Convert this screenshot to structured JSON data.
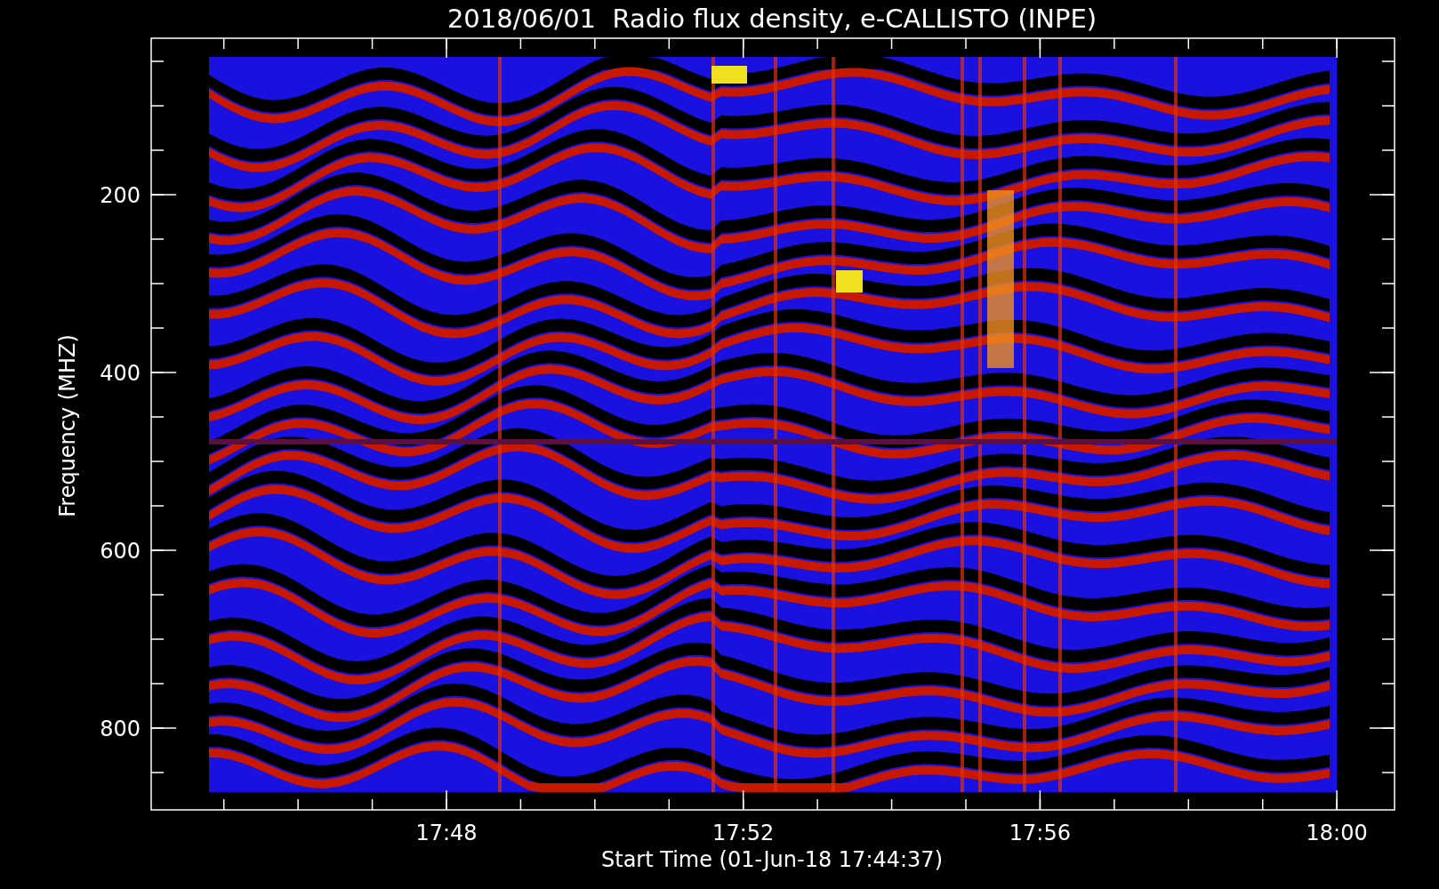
{
  "title": "2018/06/01  Radio flux density, e-CALLISTO (INPE)",
  "x_axis": {
    "label": "Start Time (01-Jun-18 17:44:37)",
    "ticks": [
      "17:48",
      "17:52",
      "17:56",
      "18:00"
    ]
  },
  "y_axis": {
    "label": "Frequency (MHZ)",
    "ticks": [
      "200",
      "400",
      "600",
      "800"
    ]
  }
}
